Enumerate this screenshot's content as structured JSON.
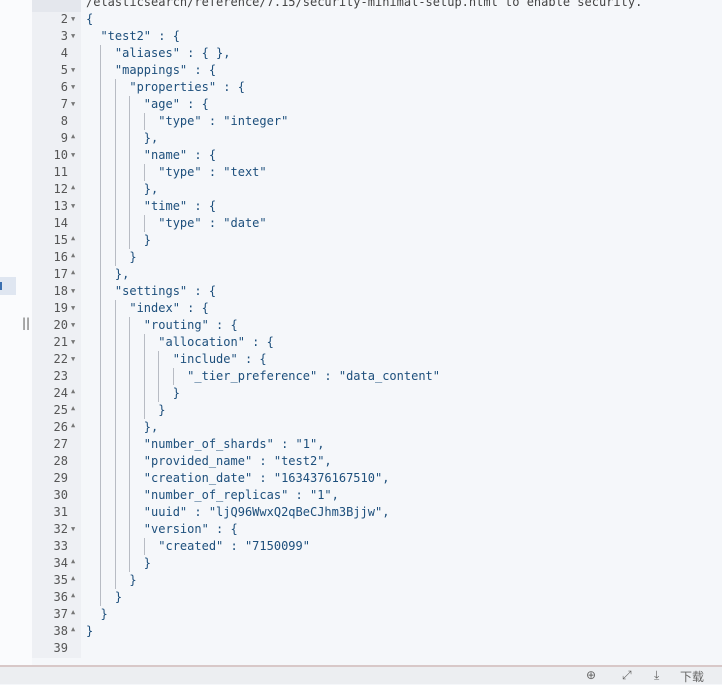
{
  "editor": {
    "first_line_text": "/elasticsearch/reference/7.15/security-minimal-setup.html to enable security.",
    "lines": [
      {
        "n": "2",
        "t": "{",
        "f": "down"
      },
      {
        "n": "3",
        "t": "  \"test2\" : {",
        "f": "down"
      },
      {
        "n": "4",
        "t": "    \"aliases\" : { },",
        "f": ""
      },
      {
        "n": "5",
        "t": "    \"mappings\" : {",
        "f": "down"
      },
      {
        "n": "6",
        "t": "      \"properties\" : {",
        "f": "down"
      },
      {
        "n": "7",
        "t": "        \"age\" : {",
        "f": "down"
      },
      {
        "n": "8",
        "t": "          \"type\" : \"integer\"",
        "f": ""
      },
      {
        "n": "9",
        "t": "        },",
        "f": "up"
      },
      {
        "n": "10",
        "t": "        \"name\" : {",
        "f": "down"
      },
      {
        "n": "11",
        "t": "          \"type\" : \"text\"",
        "f": ""
      },
      {
        "n": "12",
        "t": "        },",
        "f": "up"
      },
      {
        "n": "13",
        "t": "        \"time\" : {",
        "f": "down"
      },
      {
        "n": "14",
        "t": "          \"type\" : \"date\"",
        "f": ""
      },
      {
        "n": "15",
        "t": "        }",
        "f": "up"
      },
      {
        "n": "16",
        "t": "      }",
        "f": "up"
      },
      {
        "n": "17",
        "t": "    },",
        "f": "up"
      },
      {
        "n": "18",
        "t": "    \"settings\" : {",
        "f": "down"
      },
      {
        "n": "19",
        "t": "      \"index\" : {",
        "f": "down"
      },
      {
        "n": "20",
        "t": "        \"routing\" : {",
        "f": "down"
      },
      {
        "n": "21",
        "t": "          \"allocation\" : {",
        "f": "down"
      },
      {
        "n": "22",
        "t": "            \"include\" : {",
        "f": "down"
      },
      {
        "n": "23",
        "t": "              \"_tier_preference\" : \"data_content\"",
        "f": ""
      },
      {
        "n": "24",
        "t": "            }",
        "f": "up"
      },
      {
        "n": "25",
        "t": "          }",
        "f": "up"
      },
      {
        "n": "26",
        "t": "        },",
        "f": "up"
      },
      {
        "n": "27",
        "t": "        \"number_of_shards\" : \"1\",",
        "f": ""
      },
      {
        "n": "28",
        "t": "        \"provided_name\" : \"test2\",",
        "f": ""
      },
      {
        "n": "29",
        "t": "        \"creation_date\" : \"1634376167510\",",
        "f": ""
      },
      {
        "n": "30",
        "t": "        \"number_of_replicas\" : \"1\",",
        "f": ""
      },
      {
        "n": "31",
        "t": "        \"uuid\" : \"ljQ96WwxQ2qBeCJhm3Bjjw\",",
        "f": ""
      },
      {
        "n": "32",
        "t": "        \"version\" : {",
        "f": "down"
      },
      {
        "n": "33",
        "t": "          \"created\" : \"7150099\"",
        "f": ""
      },
      {
        "n": "34",
        "t": "        }",
        "f": "up"
      },
      {
        "n": "35",
        "t": "      }",
        "f": "up"
      },
      {
        "n": "36",
        "t": "    }",
        "f": "up"
      },
      {
        "n": "37",
        "t": "  }",
        "f": "up"
      },
      {
        "n": "38",
        "t": "}",
        "f": "up"
      },
      {
        "n": "39",
        "t": "",
        "f": ""
      }
    ]
  },
  "bottom_bar": {
    "icons": [
      "settings-icon",
      "pin-icon",
      "download-icon"
    ],
    "download_label": "下载"
  }
}
